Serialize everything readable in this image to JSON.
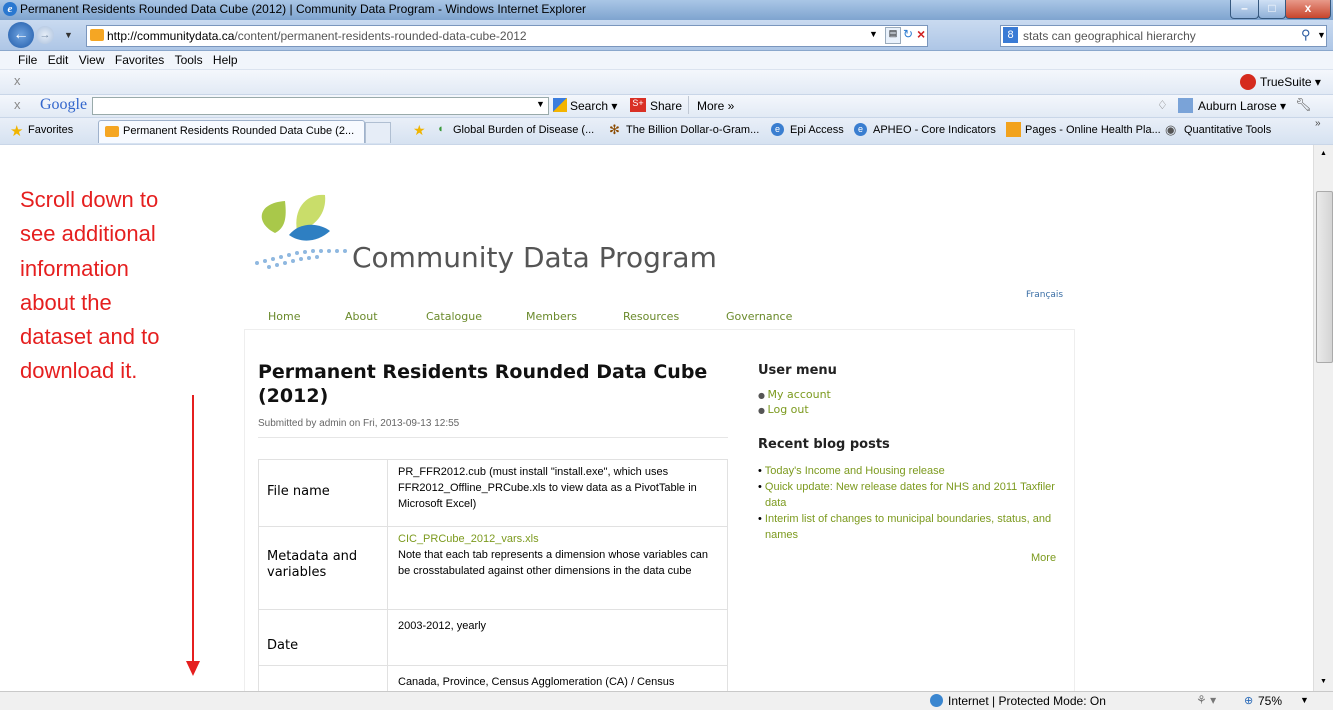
{
  "window": {
    "title": "Permanent Residents Rounded Data Cube (2012) | Community Data Program - Windows Internet Explorer"
  },
  "address": {
    "url_host": "http://communitydata.ca",
    "url_path": "/content/permanent-residents-rounded-data-cube-2012"
  },
  "search": {
    "query": "stats can geographical hierarchy"
  },
  "menu": {
    "items": [
      "File",
      "Edit",
      "View",
      "Favorites",
      "Tools",
      "Help"
    ]
  },
  "toolbar1": {
    "close": "x",
    "truesuite": "TrueSuite ▾"
  },
  "toolbar2": {
    "close": "x",
    "google": "Google",
    "search_label": "Search ▾",
    "share": "Share",
    "more": "More »",
    "user": "Auburn Larose ▾"
  },
  "tabs": {
    "favorites": "Favorites",
    "active_tab": "Permanent Residents Rounded Data Cube (2...",
    "favlinks": [
      "Global Burden of Disease (...",
      "The Billion Dollar-o-Gram...",
      "Epi Access",
      "APHEO - Core Indicators",
      "Pages - Online Health Pla...",
      "Quantitative Tools"
    ]
  },
  "annotation": {
    "lines": [
      "Scroll down to",
      "see additional",
      "information",
      "about the",
      "dataset and to",
      "download it."
    ]
  },
  "site": {
    "title": "Community Data Program",
    "francais": "Français",
    "nav": [
      "Home",
      "About",
      "Catalogue",
      "Members",
      "Resources",
      "Governance"
    ]
  },
  "article": {
    "title_line1": "Permanent Residents Rounded Data Cube",
    "title_line2": "(2012)",
    "submitted": "Submitted by admin on Fri, 2013-09-13 12:55",
    "rows": [
      {
        "label": "File name",
        "value": "PR_FFR2012.cub (must install \"install.exe\", which uses FFR2012_Offline_PRCube.xls to view data as a PivotTable in Microsoft Excel)",
        "link": ""
      },
      {
        "label_line1": "Metadata and",
        "label_line2": "variables",
        "link": "CIC_PRCube_2012_vars.xls",
        "value": "Note that each tab represents a dimension whose variables can be crosstabulated against other dimensions in the data cube"
      },
      {
        "label": "Date",
        "value": "2003-2012, yearly",
        "link": ""
      },
      {
        "label": "",
        "value": "Canada, Province, Census Agglomeration (CA) / Census",
        "link": ""
      }
    ]
  },
  "sidebar": {
    "user_menu_title": "User menu",
    "user_links": [
      "My account",
      "Log out"
    ],
    "blog_title": "Recent blog posts",
    "posts": [
      "Today's Income and Housing release",
      "Quick update: New release dates for NHS and 2011 Taxfiler data",
      "Interim list of changes to municipal boundaries, status, and names"
    ],
    "more": "More"
  },
  "status": {
    "zone": "Internet | Protected Mode: On",
    "zoom": "75%"
  }
}
